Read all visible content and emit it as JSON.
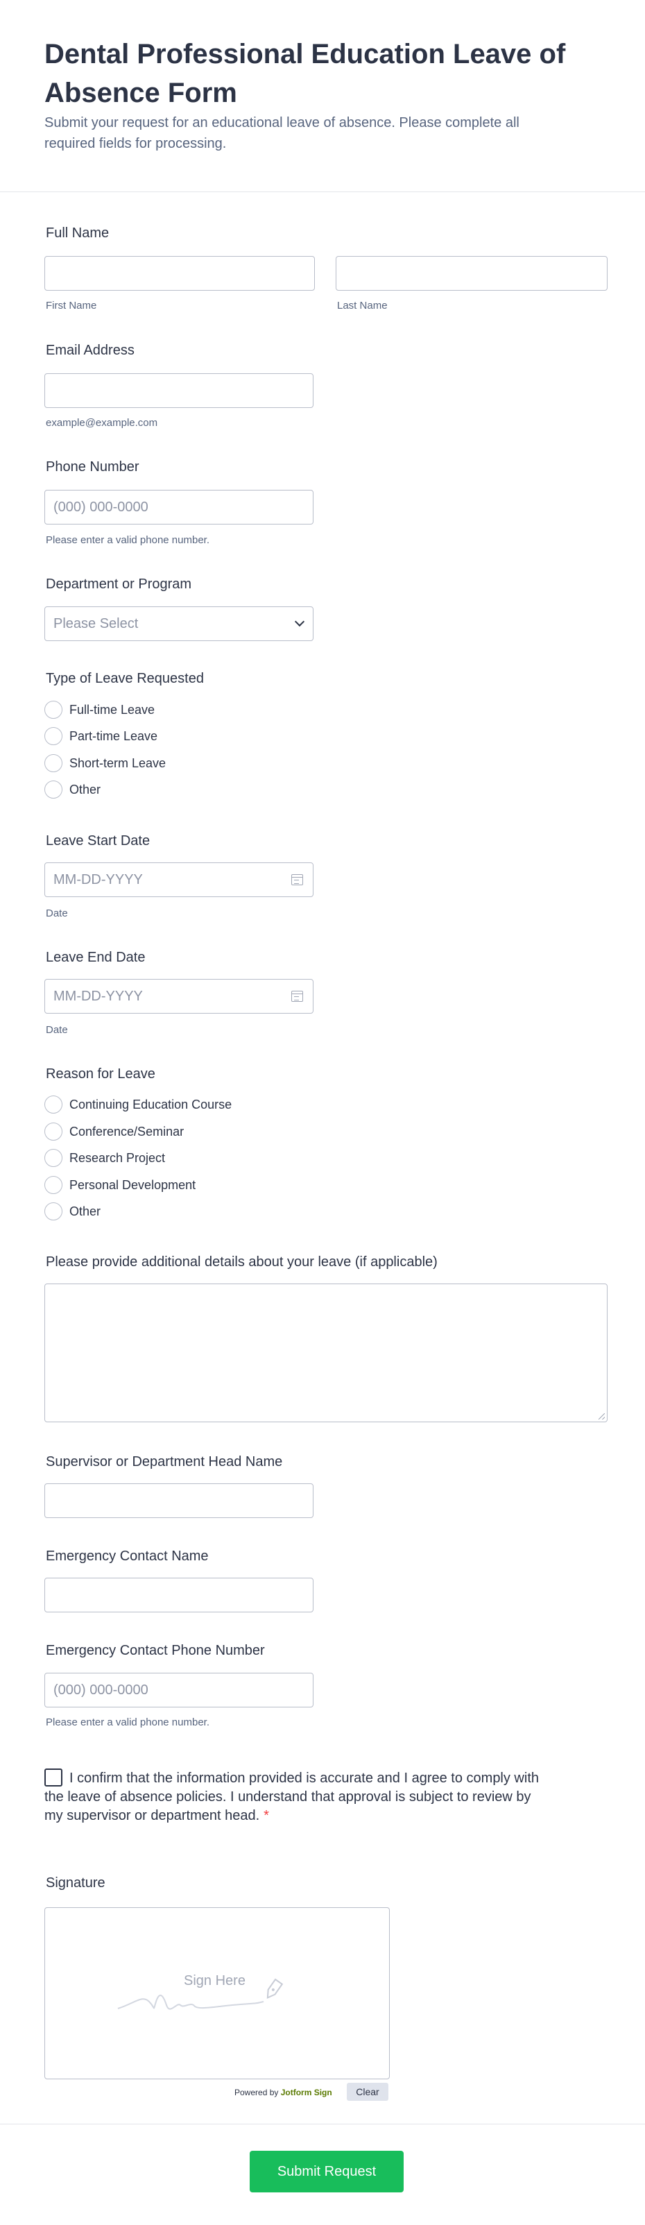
{
  "header": {
    "title": "Dental Professional Education Leave of Absence Form",
    "subtitle": "Submit your request for an educational leave of absence. Please complete all required fields for processing."
  },
  "full_name": {
    "label": "Full Name",
    "first_sublabel": "First Name",
    "last_sublabel": "Last Name",
    "first_value": "",
    "last_value": ""
  },
  "email": {
    "label": "Email Address",
    "sublabel": "example@example.com",
    "value": ""
  },
  "phone": {
    "label": "Phone Number",
    "placeholder": "(000) 000-0000",
    "sublabel": "Please enter a valid phone number."
  },
  "department": {
    "label": "Department or Program",
    "selected": "Please Select"
  },
  "leave_type": {
    "label": "Type of Leave Requested",
    "options": [
      "Full-time Leave",
      "Part-time Leave",
      "Short-term Leave",
      "Other"
    ]
  },
  "start_date": {
    "label": "Leave Start Date",
    "placeholder": "MM-DD-YYYY",
    "sublabel": "Date"
  },
  "end_date": {
    "label": "Leave End Date",
    "placeholder": "MM-DD-YYYY",
    "sublabel": "Date"
  },
  "reason": {
    "label": "Reason for Leave",
    "options": [
      "Continuing Education Course",
      "Conference/Seminar",
      "Research Project",
      "Personal Development",
      "Other"
    ]
  },
  "details": {
    "label": "Please provide additional details about your leave (if applicable)",
    "value": ""
  },
  "supervisor": {
    "label": "Supervisor or Department Head Name",
    "value": ""
  },
  "emergency_name": {
    "label": "Emergency Contact Name",
    "value": ""
  },
  "emergency_phone": {
    "label": "Emergency Contact Phone Number",
    "placeholder": "(000) 000-0000",
    "sublabel": "Please enter a valid phone number."
  },
  "consent": {
    "text": "I confirm that the information provided is accurate and I agree to comply with the leave of absence policies. I understand that approval is subject to review by my supervisor or department head.",
    "required_mark": "*"
  },
  "signature": {
    "label": "Signature",
    "hint": "Sign Here",
    "powered_prefix": "Powered by",
    "powered_brand": "Jotform Sign",
    "clear_label": "Clear"
  },
  "submit": {
    "label": "Submit Request"
  },
  "colors": {
    "accent": "#18bd5b",
    "required": "#f23a3c",
    "text": "#2c3345",
    "muted": "#57647e",
    "border": "#b8bdc9"
  }
}
